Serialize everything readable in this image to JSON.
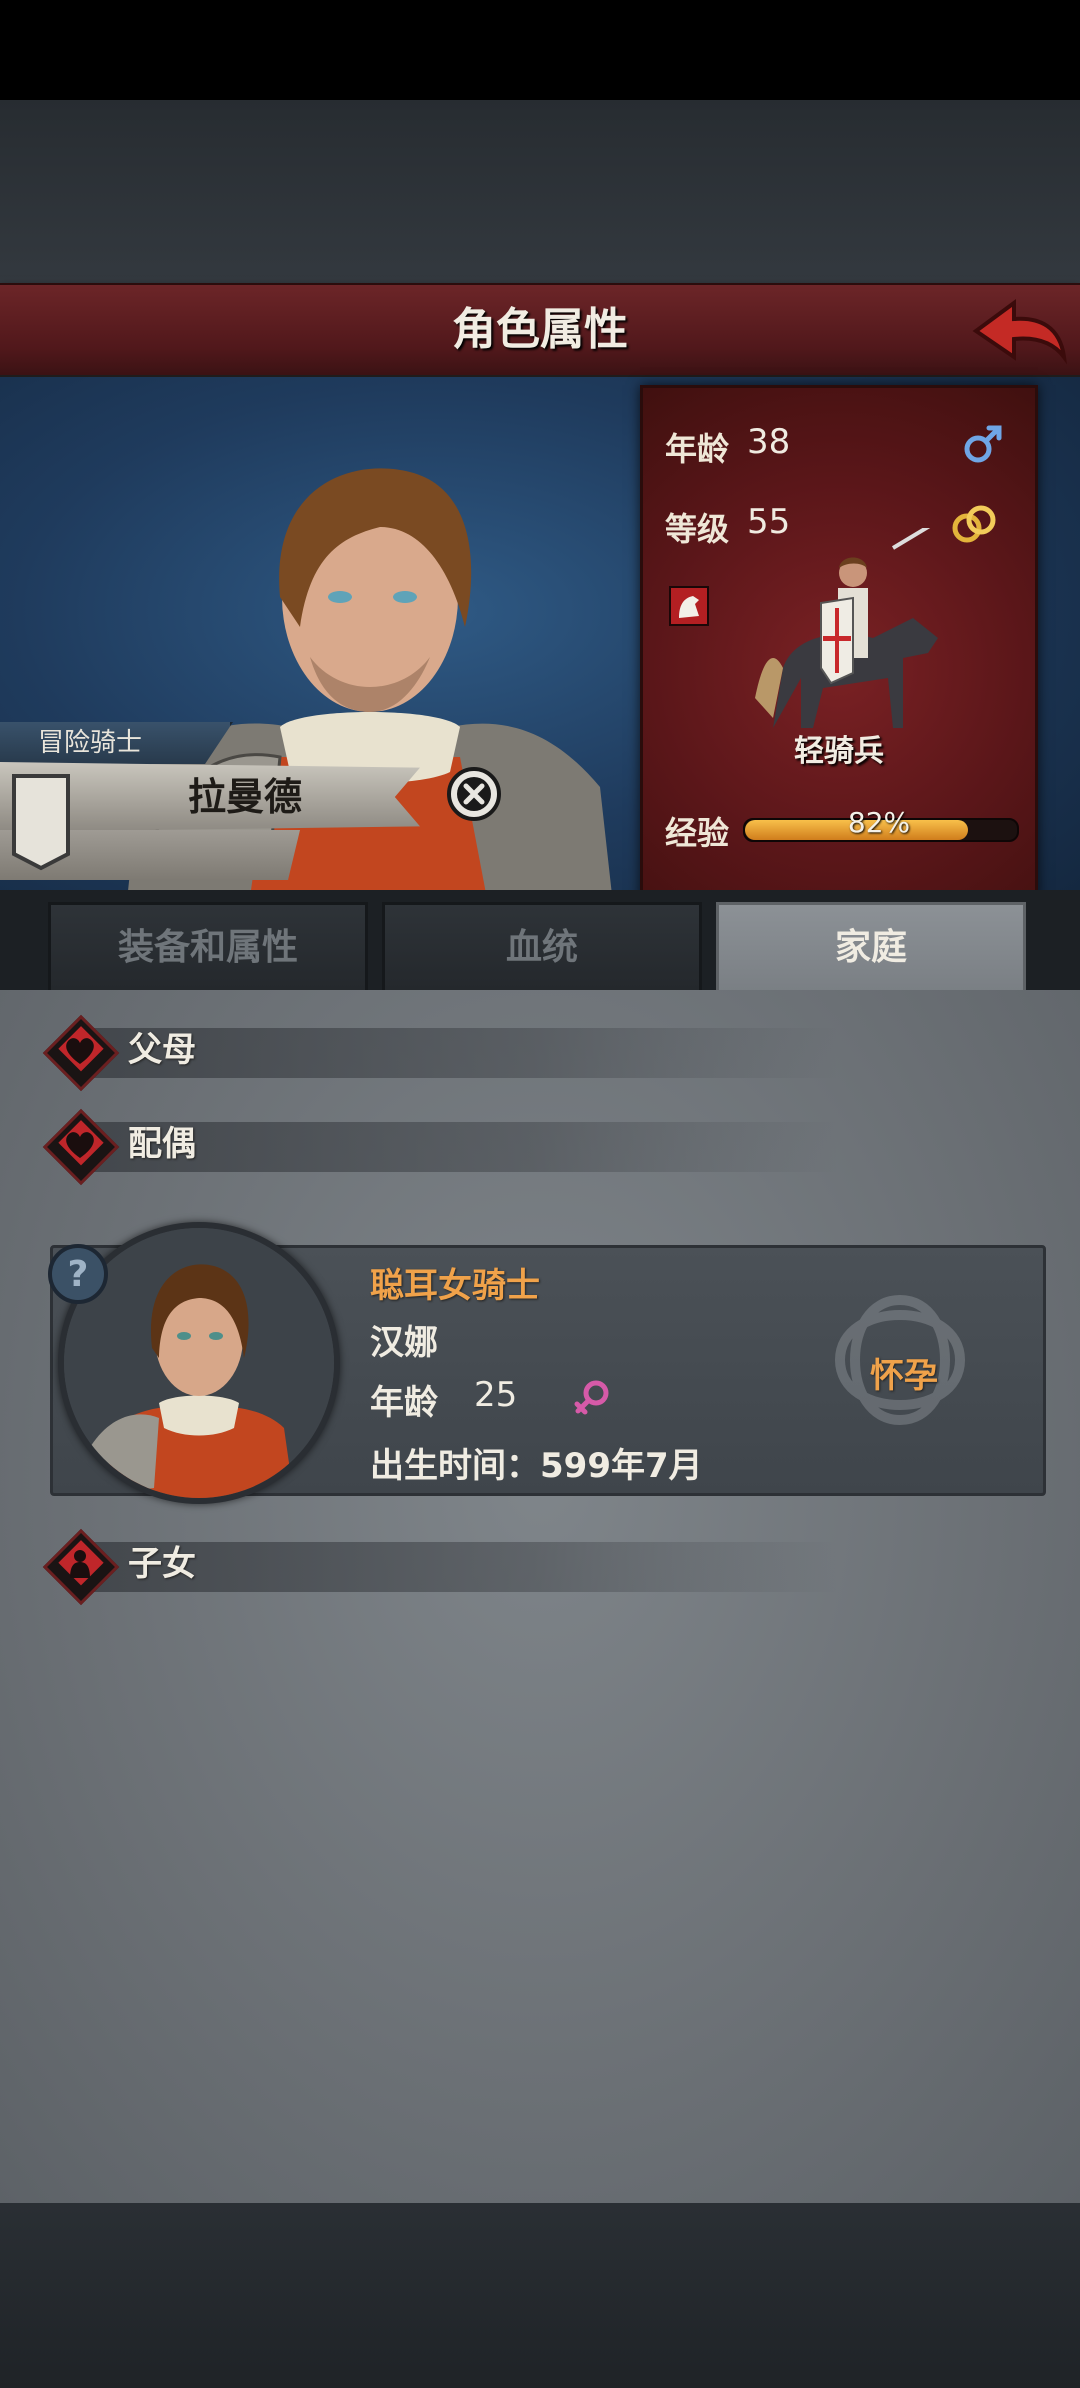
{
  "header": {
    "title": "角色属性"
  },
  "hero": {
    "rank": "冒险骑士",
    "name": "拉曼德"
  },
  "stats": {
    "age_label": "年龄",
    "age": "38",
    "level_label": "等级",
    "level": "55",
    "unit_type": "轻骑兵",
    "exp_label": "经验",
    "exp_percent_text": "82%",
    "exp_fraction": 0.82
  },
  "tabs": [
    {
      "label": "装备和属性",
      "active": false
    },
    {
      "label": "血统",
      "active": false
    },
    {
      "label": "家庭",
      "active": true
    }
  ],
  "family": {
    "parents_label": "父母",
    "spouse_label": "配偶",
    "children_label": "子女",
    "spouse": {
      "title": "聪耳女骑士",
      "name": "汉娜",
      "age_label": "年龄",
      "age": "25",
      "birth": "出生时间：599年7月",
      "status": "怀孕"
    }
  },
  "colors": {
    "accent_red": "#c0262a",
    "title_bar": "#5a1a1d",
    "highlight_orange": "#f0a24a",
    "exp_fill": "#f2a935"
  }
}
